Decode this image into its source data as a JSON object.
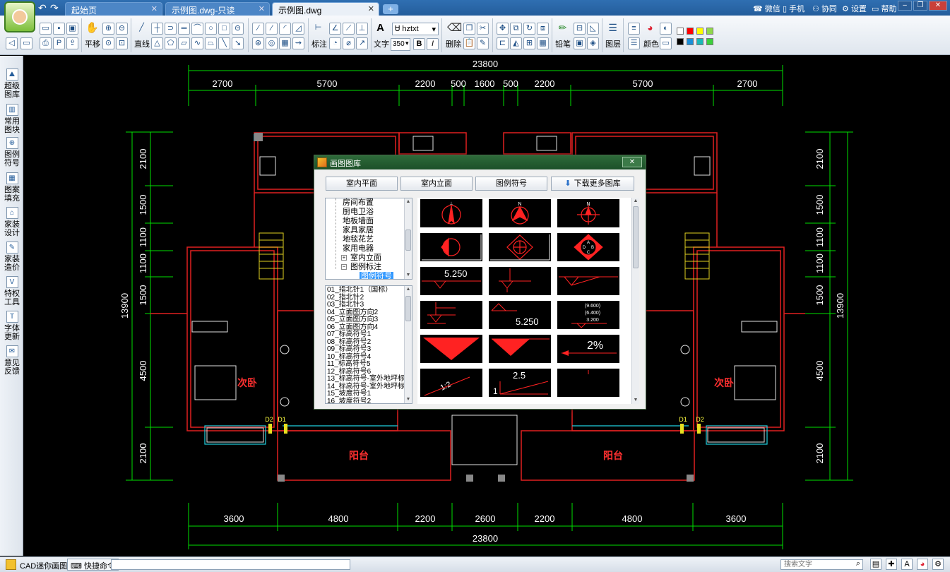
{
  "titlebar": {
    "tabs": [
      {
        "label": "起始页",
        "active": false
      },
      {
        "label": "示例图.dwg-只读",
        "active": false
      },
      {
        "label": "示例图.dwg",
        "active": true
      }
    ],
    "new_tab": "+",
    "links": [
      "微信",
      "手机",
      "协同",
      "设置",
      "帮助"
    ],
    "window_buttons": [
      "–",
      "❐",
      "✕"
    ]
  },
  "toolbar": {
    "groups": {
      "pan": "平移",
      "line": "直线",
      "dimension": "标注",
      "text": "文字",
      "font": "hztxt",
      "font_size": "350",
      "bold": "B",
      "italic": "I",
      "delete": "删除",
      "pencil": "铅笔",
      "layer": "图层",
      "color": "颜色"
    },
    "swatches": [
      "#ffffff",
      "#ff0000",
      "#ffff00",
      "#90d84a",
      "#000000",
      "#1a8fd8",
      "#1ab8b8",
      "#3cd03c"
    ]
  },
  "sidebar": {
    "items": [
      {
        "label": "超级图库",
        "icon": "landscape-icon"
      },
      {
        "label": "常用图块",
        "icon": "block-icon"
      },
      {
        "label": "图例符号",
        "icon": "compass-icon"
      },
      {
        "label": "图案填充",
        "icon": "hatch-icon"
      },
      {
        "label": "家装设计",
        "icon": "design-icon"
      },
      {
        "label": "家装造价",
        "icon": "pencil-icon"
      },
      {
        "label": "特权工具",
        "icon": "privilege-icon"
      },
      {
        "label": "字体更新",
        "icon": "font-icon"
      },
      {
        "label": "意见反馈",
        "icon": "mail-icon"
      }
    ]
  },
  "drawing": {
    "top_total": "23800",
    "top_dims": [
      "2700",
      "5700",
      "2200",
      "500",
      "1600",
      "500",
      "2200",
      "5700",
      "2700"
    ],
    "bottom_dims": [
      "3600",
      "4800",
      "2200",
      "2600",
      "2200",
      "4800",
      "3600"
    ],
    "bottom_total": "23800",
    "left_total": "13900",
    "right_total": "13900",
    "side_dims": [
      "2100",
      "1500",
      "1100",
      "1100",
      "1500",
      "4500",
      "2100"
    ],
    "room_labels": [
      "次卧",
      "次卧",
      "阳台",
      "阳台"
    ],
    "tags": [
      "D2",
      "D1",
      "D1",
      "D2"
    ]
  },
  "dialog": {
    "title": "画图图库",
    "close": "✕",
    "tabs": [
      "室内平面",
      "室内立面",
      "图例符号"
    ],
    "download_more": "下载更多图库",
    "tree": [
      {
        "label": "房间布置",
        "type": "leaf"
      },
      {
        "label": "厨电卫浴",
        "type": "leaf"
      },
      {
        "label": "地板墙面",
        "type": "leaf"
      },
      {
        "label": "家具家居",
        "type": "leaf"
      },
      {
        "label": "地毯花艺",
        "type": "leaf"
      },
      {
        "label": "家用电器",
        "type": "leaf"
      },
      {
        "label": "室内立面",
        "type": "collapsed"
      },
      {
        "label": "图例标注",
        "type": "expanded"
      },
      {
        "label": "图例符号",
        "type": "selected"
      }
    ],
    "list": [
      "01_指北针1（国标）",
      "02_指北针2",
      "03_指北针3",
      "04_立面图方向2",
      "05_立面图方向3",
      "06_立面图方向4",
      "07_标高符号1",
      "08_标高符号2",
      "09_标高符号3",
      "10_标高符号4",
      "11_标高符号5",
      "12_标高符号6",
      "13_标高符号-室外地坪标",
      "14_标高符号-室外地坪标",
      "15_坡度符号1",
      "16_坡度符号2"
    ],
    "thumb_texts": {
      "elev1": "5.250",
      "elev2": "5.250",
      "elev3a": "(9.600)",
      "elev3b": "(6.400)",
      "elev3c": "3.200",
      "slope_pct": "2%",
      "slope_ratio": "1:2",
      "slope_num": "2.5",
      "slope_one": "1",
      "north_n": "N",
      "north_a": "A",
      "north_b": "B",
      "north_c": "C",
      "north_d": "D"
    }
  },
  "statusbar": {
    "app_name": "CAD迷你画图",
    "quick_cmd": "快捷命令",
    "search_placeholder": "搜索文字"
  }
}
